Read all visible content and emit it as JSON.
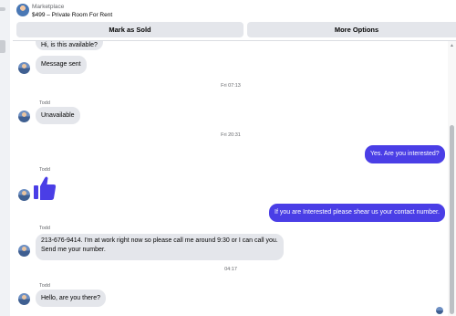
{
  "header": {
    "marketplace_label": "Marketplace",
    "listing_title": "$499 – Private Room For Rent",
    "mark_sold_label": "Mark as Sold",
    "more_options_label": "More Options"
  },
  "messages": [
    {
      "text": "Hi, is this available?"
    },
    {
      "text": "Message sent"
    },
    {
      "timestamp": "Fri 07:13"
    },
    {
      "sender": "Todd",
      "text": "Unavailable"
    },
    {
      "timestamp": "Fri 20:31"
    },
    {
      "text": "Yes. Are you interested?"
    },
    {
      "sender": "Todd",
      "icon": "thumbs-up-icon"
    },
    {
      "text": "If you are Interested please shear us your contact number."
    },
    {
      "sender": "Todd",
      "line1": "213-676-9414. I'm at work right now so please call me around 9:30 or I can call you.",
      "line2": "Send me your number."
    },
    {
      "timestamp": "04:17"
    },
    {
      "sender": "Todd",
      "text": "Hello, are you there?"
    }
  ],
  "colors": {
    "outgoing_bubble": "#4a3ee6",
    "incoming_bubble": "#e4e6eb",
    "like_icon": "#4a3ee6"
  }
}
